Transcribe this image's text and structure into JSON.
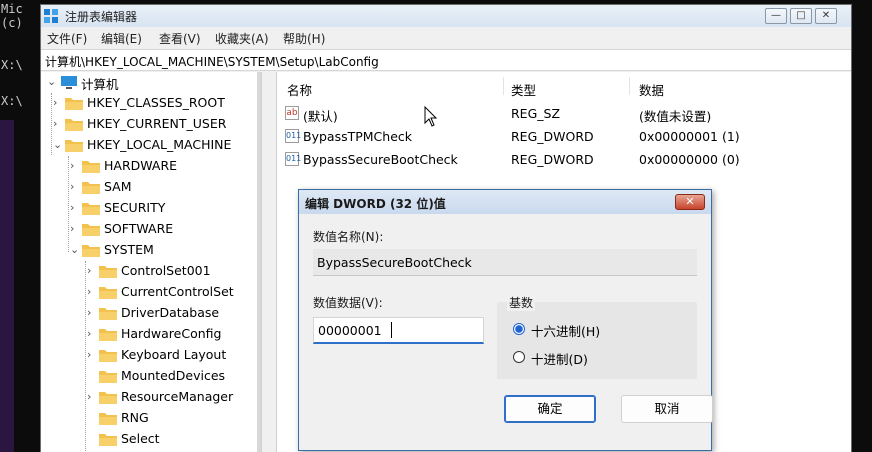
{
  "console": {
    "lines": [
      "Mic",
      "(c)",
      "",
      "X:\\",
      "",
      "X:\\"
    ]
  },
  "window": {
    "title": "注册表编辑器",
    "controls": {
      "minimize": "—",
      "maximize": "□",
      "close": "✕"
    }
  },
  "menu": [
    "文件(F)",
    "编辑(E)",
    "查看(V)",
    "收藏夹(A)",
    "帮助(H)"
  ],
  "address": "计算机\\HKEY_LOCAL_MACHINE\\SYSTEM\\Setup\\LabConfig",
  "tree": {
    "root": "计算机",
    "items": [
      "HKEY_CLASSES_ROOT",
      "HKEY_CURRENT_USER",
      "HKEY_LOCAL_MACHINE",
      "HARDWARE",
      "SAM",
      "SECURITY",
      "SOFTWARE",
      "SYSTEM",
      "ControlSet001",
      "CurrentControlSet",
      "DriverDatabase",
      "HardwareConfig",
      "Keyboard Layout",
      "MountedDevices",
      "ResourceManager",
      "RNG",
      "Select"
    ]
  },
  "list": {
    "headers": [
      "名称",
      "类型",
      "数据"
    ],
    "rows": [
      {
        "icon": "string-value-icon",
        "name": "(默认)",
        "type": "REG_SZ",
        "data": "(数值未设置)"
      },
      {
        "icon": "dword-value-icon",
        "name": "BypassTPMCheck",
        "type": "REG_DWORD",
        "data": "0x00000001 (1)"
      },
      {
        "icon": "dword-value-icon",
        "name": "BypassSecureBootCheck",
        "type": "REG_DWORD",
        "data": "0x00000000 (0)"
      }
    ]
  },
  "dialog": {
    "title": "编辑 DWORD (32 位)值",
    "close": "✕",
    "name_label": "数值名称(N):",
    "name_value": "BypassSecureBootCheck",
    "data_label": "数值数据(V):",
    "data_value": "00000001",
    "base_label": "基数",
    "hex_label": "十六进制(H)",
    "dec_label": "十进制(D)",
    "selected_base": "hex",
    "ok": "确定",
    "cancel": "取消"
  },
  "colors": {
    "folder": "#f2c14e",
    "accent": "#2f6fc7",
    "computer_icon": "#2a8fd8"
  }
}
